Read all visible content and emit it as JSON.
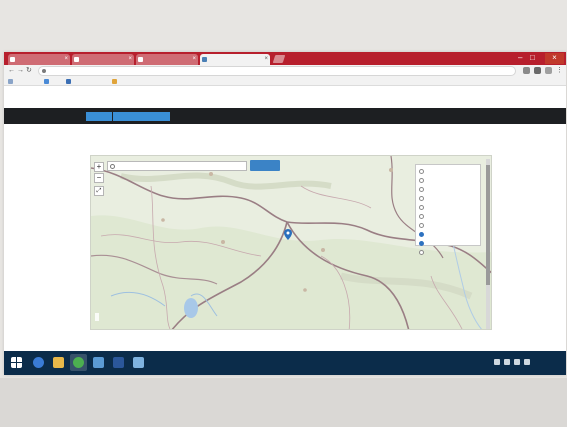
{
  "browser": {
    "tabs": [
      {
        "title": "",
        "active": false
      },
      {
        "title": "",
        "active": false
      },
      {
        "title": "",
        "active": false
      },
      {
        "title": "",
        "active": true
      }
    ],
    "address": "",
    "bookmarks": [
      "",
      "",
      "",
      ""
    ]
  },
  "site": {
    "header_text": "",
    "nav": [
      {
        "label": "",
        "active": true
      },
      {
        "label": "",
        "active": true
      },
      {
        "label": "",
        "active": false
      },
      {
        "label": "",
        "active": false
      },
      {
        "label": "",
        "active": false
      }
    ]
  },
  "map_section": {
    "heading": "",
    "search_placeholder": "",
    "find_button": "",
    "layers": [
      {
        "label": "",
        "checked": false
      },
      {
        "label": "",
        "checked": false
      },
      {
        "label": "",
        "checked": false
      },
      {
        "label": "",
        "checked": false
      },
      {
        "label": "",
        "checked": false
      },
      {
        "label": "",
        "checked": false
      },
      {
        "label": "",
        "checked": false
      },
      {
        "label": "",
        "checked": true
      },
      {
        "label": "",
        "checked": true
      },
      {
        "label": "",
        "checked": false
      }
    ],
    "attribution": "",
    "copyright": "",
    "logo": ""
  },
  "caption": "",
  "taskbar": {
    "apps": [
      "start-icon",
      "ie-icon",
      "folder-icon",
      "chrome-icon",
      "media-icon",
      "word-icon",
      "app-icon"
    ],
    "clock": ""
  },
  "colors": {
    "tabstrip": "#b71f2d",
    "navbar": "#1d1f22",
    "nav_active": "#3a8fd6",
    "map_button": "#3b83c6",
    "marker": "#2a6fbd",
    "taskbar": "#0b2c4a"
  }
}
